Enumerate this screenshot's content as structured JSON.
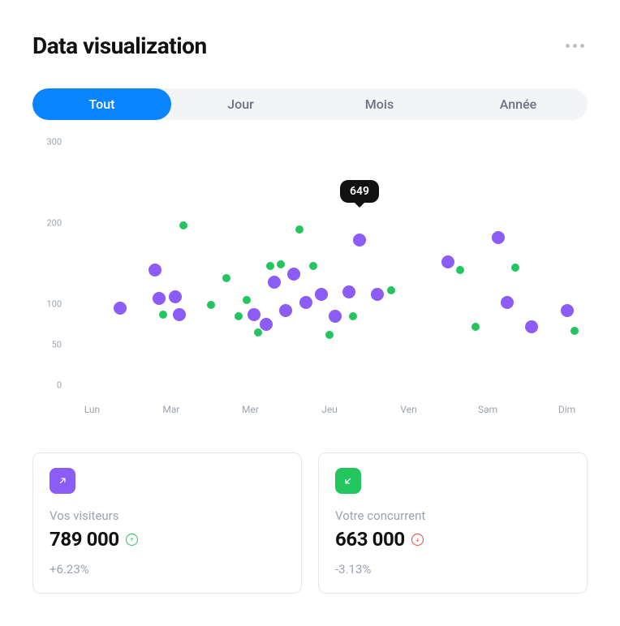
{
  "header": {
    "title": "Data visualization"
  },
  "segments": {
    "items": [
      "Tout",
      "Jour",
      "Mois",
      "Année"
    ],
    "active": 0
  },
  "chart_data": {
    "type": "scatter",
    "xlabel": "",
    "ylabel": "",
    "ylim": [
      0,
      300
    ],
    "x_categories": [
      "Lun",
      "Mar",
      "Mer",
      "Jeu",
      "Ven",
      "Sam",
      "Dim"
    ],
    "y_ticks": [
      0,
      50,
      100,
      200,
      300
    ],
    "tooltip": {
      "value": "649",
      "on": {
        "series_index": 0,
        "point_index": 14
      }
    },
    "series": [
      {
        "name": "Vos visiteurs",
        "color": "#8b5cf6",
        "point_radius": 8,
        "points": [
          {
            "x": 0.35,
            "y": 108
          },
          {
            "x": 0.8,
            "y": 155
          },
          {
            "x": 0.85,
            "y": 120
          },
          {
            "x": 1.05,
            "y": 122
          },
          {
            "x": 1.1,
            "y": 100
          },
          {
            "x": 2.05,
            "y": 100
          },
          {
            "x": 2.2,
            "y": 88
          },
          {
            "x": 2.3,
            "y": 140
          },
          {
            "x": 2.45,
            "y": 105
          },
          {
            "x": 2.55,
            "y": 150
          },
          {
            "x": 2.7,
            "y": 115
          },
          {
            "x": 2.9,
            "y": 125
          },
          {
            "x": 3.07,
            "y": 98
          },
          {
            "x": 3.25,
            "y": 128
          },
          {
            "x": 3.38,
            "y": 192
          },
          {
            "x": 3.6,
            "y": 125
          },
          {
            "x": 4.5,
            "y": 165
          },
          {
            "x": 5.13,
            "y": 195
          },
          {
            "x": 5.25,
            "y": 115
          },
          {
            "x": 5.55,
            "y": 85
          },
          {
            "x": 6.0,
            "y": 105
          }
        ]
      },
      {
        "name": "Votre concurrent",
        "color": "#22c55e",
        "point_radius": 5,
        "points": [
          {
            "x": 0.9,
            "y": 100
          },
          {
            "x": 1.15,
            "y": 210
          },
          {
            "x": 1.5,
            "y": 112
          },
          {
            "x": 1.7,
            "y": 145
          },
          {
            "x": 1.85,
            "y": 98
          },
          {
            "x": 1.95,
            "y": 118
          },
          {
            "x": 2.1,
            "y": 78
          },
          {
            "x": 2.25,
            "y": 160
          },
          {
            "x": 2.38,
            "y": 162
          },
          {
            "x": 2.62,
            "y": 205
          },
          {
            "x": 2.8,
            "y": 160
          },
          {
            "x": 3.0,
            "y": 75
          },
          {
            "x": 3.3,
            "y": 98
          },
          {
            "x": 3.78,
            "y": 130
          },
          {
            "x": 4.65,
            "y": 155
          },
          {
            "x": 4.85,
            "y": 85
          },
          {
            "x": 5.35,
            "y": 158
          },
          {
            "x": 6.1,
            "y": 80
          }
        ]
      }
    ]
  },
  "cards": {
    "left": {
      "label": "Vos visiteurs",
      "value": "789 000",
      "delta": "+6.23%",
      "trend": "up"
    },
    "right": {
      "label": "Votre concurrent",
      "value": "663 000",
      "delta": "-3.13%",
      "trend": "down"
    }
  }
}
